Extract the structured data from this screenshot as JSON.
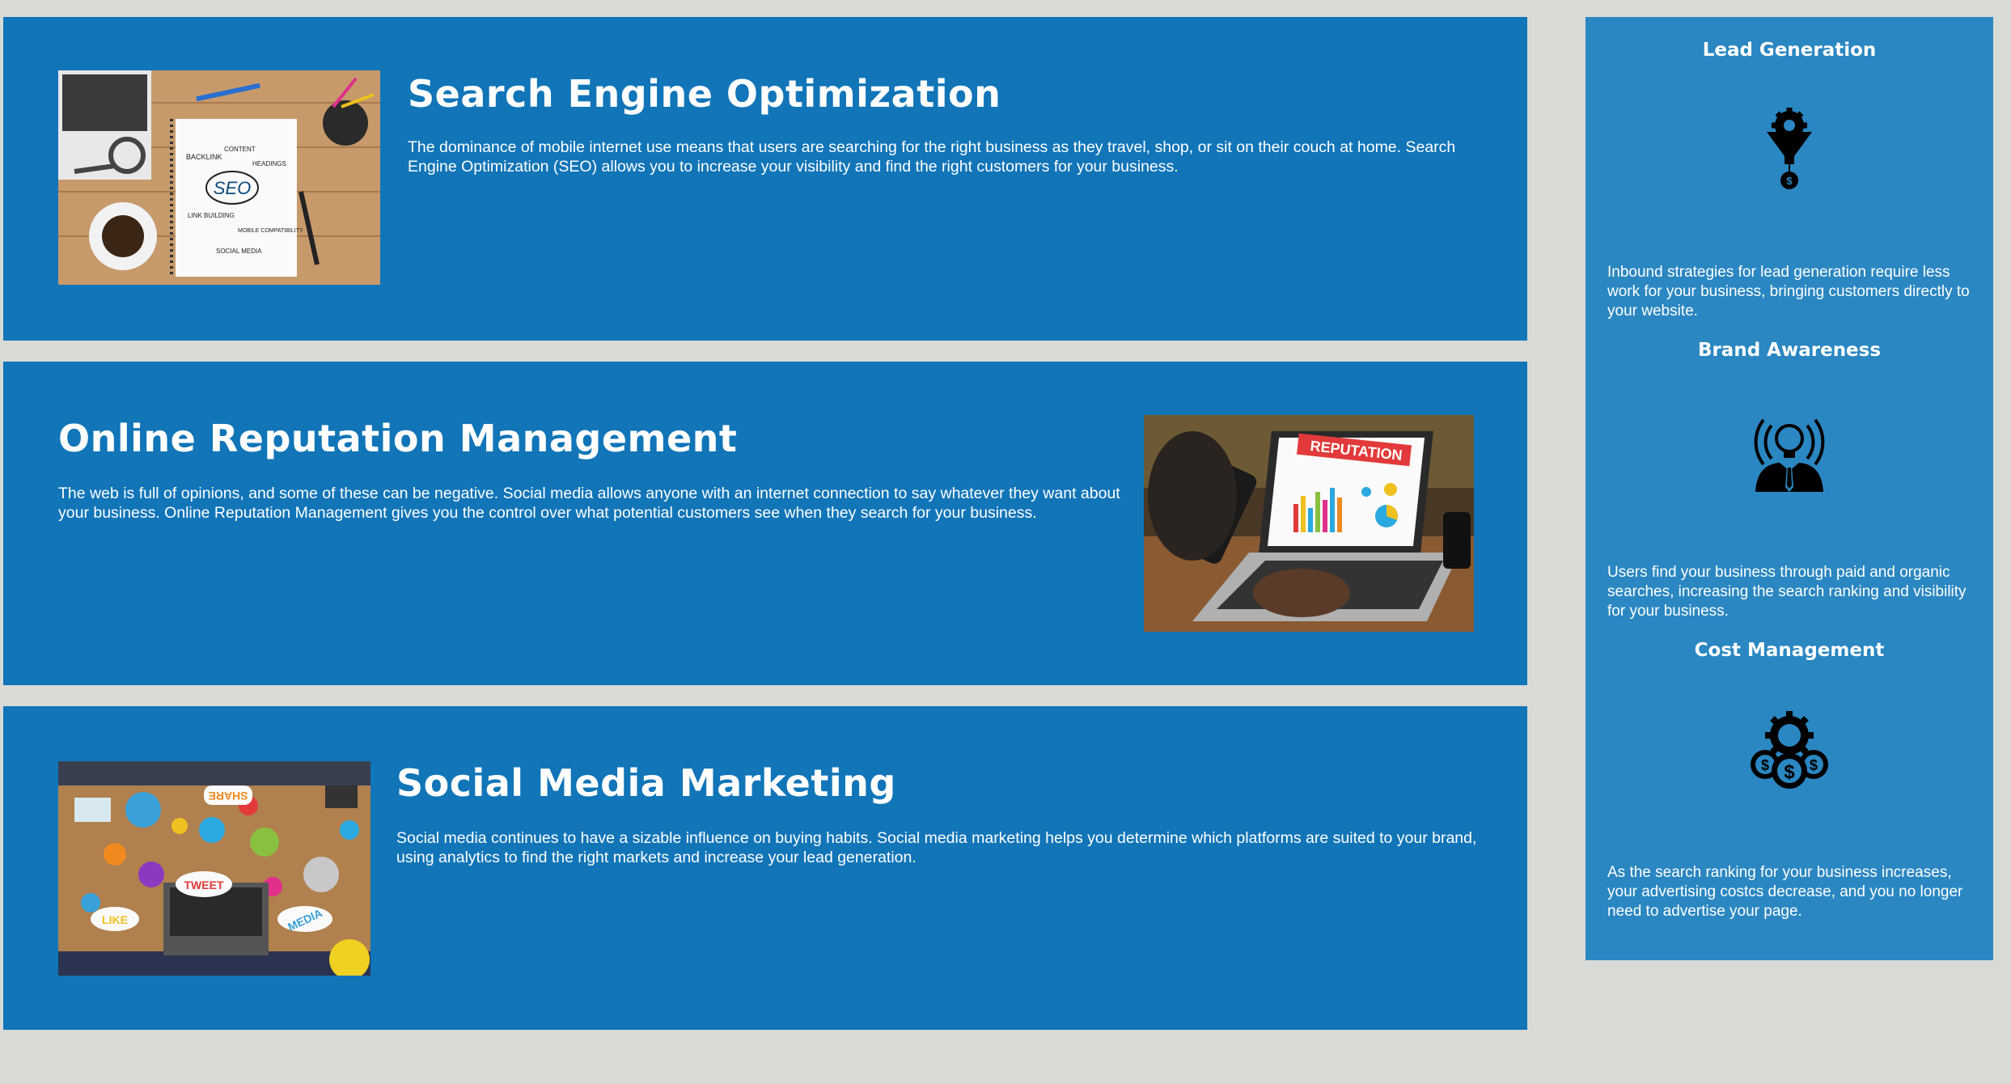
{
  "services": [
    {
      "title": "Search Engine Optimization",
      "text": "The dominance of mobile internet use means that users are searching for the right business as they travel, shop, or sit on their couch at home. Search Engine Optimization (SEO) allows you to increase your visibility and find the right customers for your business.",
      "image_words": [
        "SEO",
        "BACKLINK",
        "CONTENT",
        "HEADINGS",
        "LINK BUILDING",
        "MOBILE COMPATIBILITY",
        "SOCIAL MEDIA"
      ]
    },
    {
      "title": "Online Reputation Management",
      "text": "The web is full of opinions, and some of these can be negative. Social media allows anyone with an internet connection to say whatever they want about your business. Online Reputation Management gives you the control over what potential customers see when they search for your business.",
      "image_words": [
        "REPUTATION"
      ]
    },
    {
      "title": "Social Media Marketing",
      "text": "Social media continues to have a sizable influence on buying habits. Social media marketing helps you determine which platforms are suited to your brand, using analytics to find the right markets and increase your lead generation.",
      "image_words": [
        "SHARE",
        "TWEET",
        "LIKE",
        "MEDIA"
      ]
    }
  ],
  "sidebar": {
    "features": [
      {
        "title": "Lead Generation",
        "icon": "funnel-gear-icon",
        "text": "Inbound strategies for lead generation require less work for your business, bringing customers directly to your website."
      },
      {
        "title": "Brand Awareness",
        "icon": "lightbulb-broadcast-icon",
        "text": "Users find your business through paid and organic searches, increasing the search ranking and visibility for your business."
      },
      {
        "title": "Cost Management",
        "icon": "gear-dollar-icon",
        "text": "As the search ranking for your business increases, your advertising costcs decrease, and you no longer need to advertise your page."
      }
    ]
  },
  "colors": {
    "panel": "#1175b8",
    "sidebar": "#2a87c1",
    "page": "#d8dad6"
  }
}
